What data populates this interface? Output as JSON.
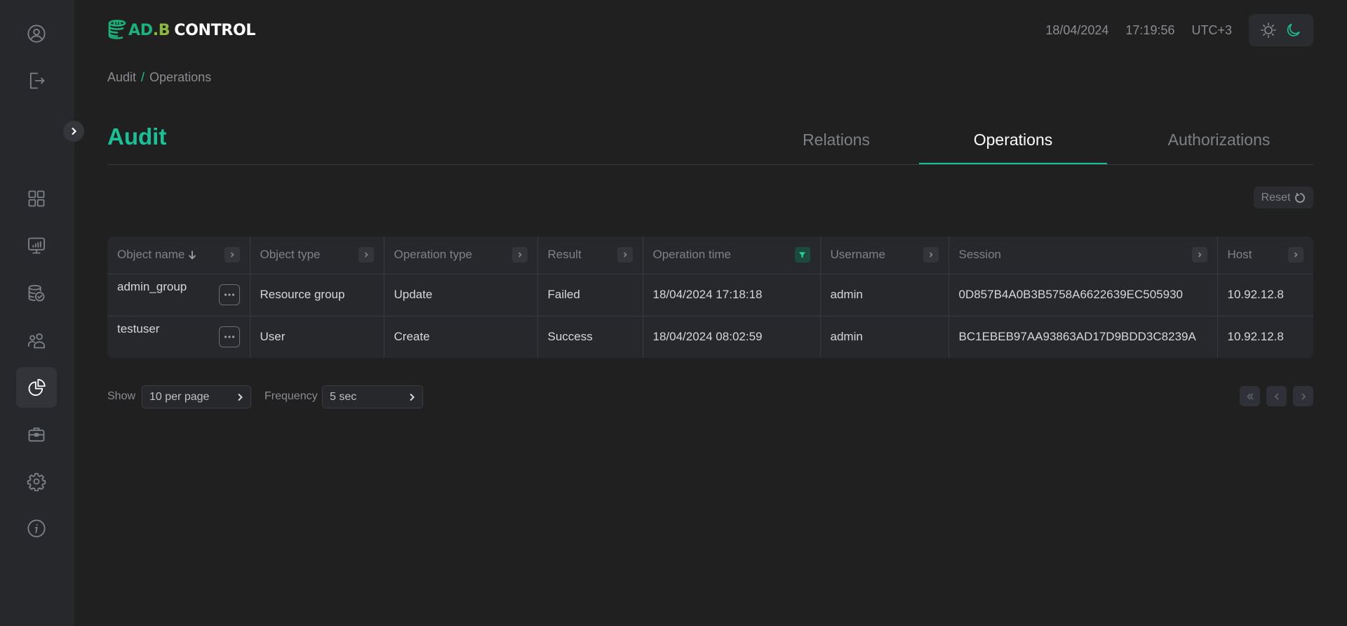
{
  "app": {
    "logo": {
      "part1": "AD",
      "dot": ".",
      "part2": "B",
      "part3": "CONTROL"
    },
    "brand_colors": {
      "accent": "#19c296",
      "logo_green": "#1bb37b",
      "logo_lime": "#8ab93b"
    }
  },
  "header": {
    "date": "18/04/2024",
    "time": "17:19:56",
    "timezone": "UTC+3",
    "theme_options": [
      "light-theme-icon",
      "dark-theme-icon"
    ],
    "active_theme": "dark"
  },
  "sidebar": {
    "top_items": [
      {
        "name": "profile",
        "icon": "user-circle-icon"
      },
      {
        "name": "logout",
        "icon": "logout-icon"
      }
    ],
    "items": [
      {
        "name": "dashboard",
        "icon": "grid-icon",
        "active": false
      },
      {
        "name": "monitoring",
        "icon": "monitor-chart-icon",
        "active": false
      },
      {
        "name": "databases",
        "icon": "database-check-icon",
        "active": false
      },
      {
        "name": "users",
        "icon": "users-icon",
        "active": false
      },
      {
        "name": "audit",
        "icon": "pie-chart-icon",
        "active": true
      },
      {
        "name": "jobs",
        "icon": "briefcase-icon",
        "active": false
      },
      {
        "name": "settings",
        "icon": "gear-icon",
        "active": false
      },
      {
        "name": "info",
        "icon": "info-icon",
        "active": false
      }
    ],
    "collapse_icon": "chevron-right-icon"
  },
  "breadcrumb": {
    "items": [
      "Audit",
      "Operations"
    ],
    "separator": "/"
  },
  "page": {
    "title": "Audit"
  },
  "tabs": [
    {
      "label": "Relations",
      "active": false
    },
    {
      "label": "Operations",
      "active": true
    },
    {
      "label": "Authorizations",
      "active": false
    }
  ],
  "toolbar": {
    "reset_label": "Reset"
  },
  "table": {
    "columns": [
      {
        "label": "Object name",
        "sorted": "desc",
        "control": "expand"
      },
      {
        "label": "Object type",
        "control": "expand"
      },
      {
        "label": "Operation type",
        "control": "expand"
      },
      {
        "label": "Result",
        "control": "expand"
      },
      {
        "label": "Operation time",
        "control": "filter-active"
      },
      {
        "label": "Username",
        "control": "expand"
      },
      {
        "label": "Session",
        "control": "expand"
      },
      {
        "label": "Host",
        "control": "expand"
      }
    ],
    "rows": [
      {
        "object_name": "admin_group",
        "object_type": "Resource group",
        "operation_type": "Update",
        "result": "Failed",
        "operation_time": "18/04/2024 17:18:18",
        "username": "admin",
        "session": "0D857B4A0B3B5758A6622639EC505930",
        "host": "10.92.12.8"
      },
      {
        "object_name": "testuser",
        "object_type": "User",
        "operation_type": "Create",
        "result": "Success",
        "operation_time": "18/04/2024 08:02:59",
        "username": "admin",
        "session": "BC1EBEB97AA93863AD17D9BDD3C8239A",
        "host": "10.92.12.8"
      }
    ]
  },
  "footer": {
    "show_label": "Show",
    "show_value": "10 per page",
    "frequency_label": "Frequency",
    "frequency_value": "5 sec",
    "pager": [
      "first-page",
      "previous-page",
      "next-page"
    ]
  }
}
